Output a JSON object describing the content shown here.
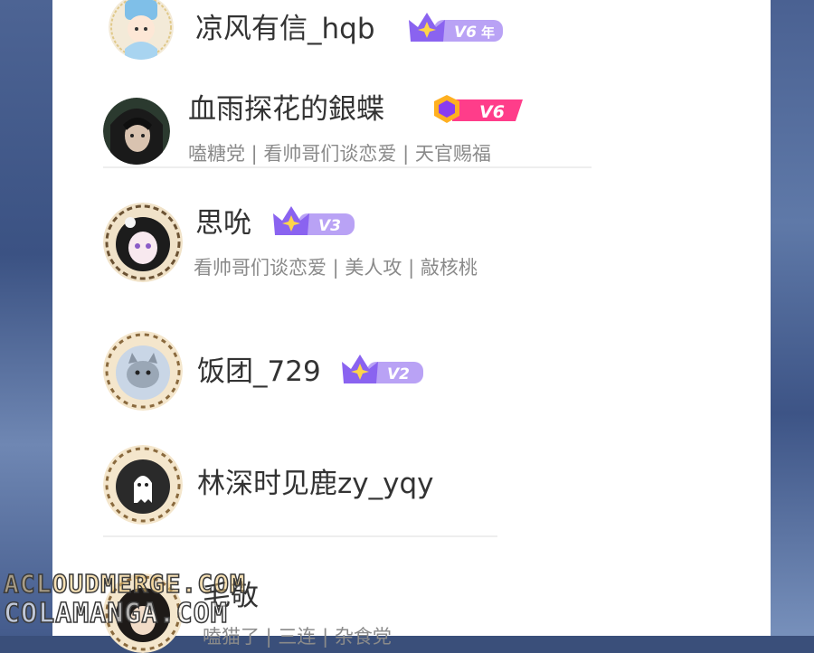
{
  "users": [
    {
      "name": "凉风有信_hqb",
      "level": "V6",
      "level_suffix": "年",
      "badge_style": "crown",
      "avatar": "blue-hat-avatar"
    },
    {
      "name": "血雨探花的銀蝶",
      "level": "V6",
      "badge_style": "hexagon-pink",
      "tags": "嗑糖党 | 看帅哥们谈恋爱 | 天官赐福",
      "avatar": "dark-hair-avatar"
    },
    {
      "name": "思吮",
      "level": "V3",
      "badge_style": "crown",
      "tags": "看帅哥们谈恋爱 | 美人攻 | 敲核桃",
      "avatar": "anime-girl-avatar"
    },
    {
      "name": "饭团_729",
      "level": "V2",
      "badge_style": "crown",
      "avatar": "cat-avatar"
    },
    {
      "name": "林深时见鹿zy_yqy",
      "avatar": "ghost-avatar"
    },
    {
      "name": "毛敬",
      "tags": "嗑猫了 | 三连 | 杂食党",
      "avatar": "girl-avatar"
    }
  ],
  "watermark": {
    "line1": "ACLOUDMERGE.COM",
    "line2": "COLAMANGA.COM"
  },
  "colors": {
    "crown_purple": "#8a63f0",
    "crown_star": "#ffd54a",
    "badge_pink": "#ff3d8a",
    "hex_gold": "#ffb020"
  }
}
